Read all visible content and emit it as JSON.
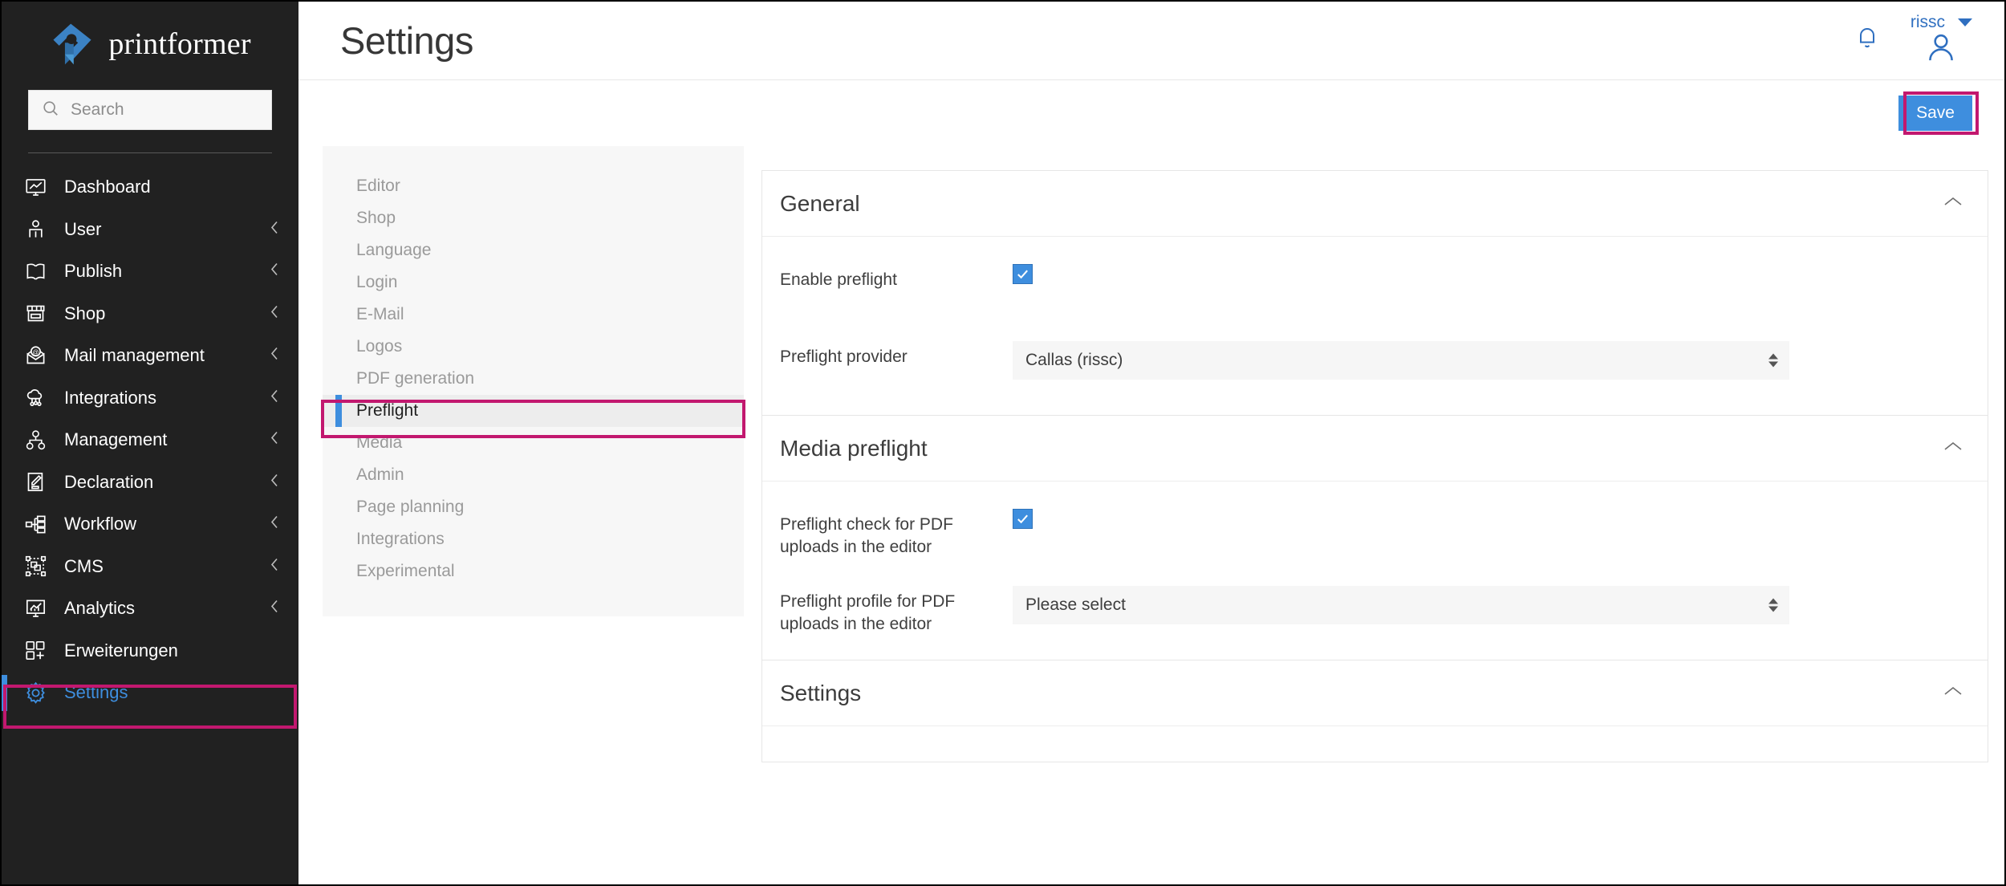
{
  "brand": {
    "name": "printformer"
  },
  "search": {
    "placeholder": "Search",
    "value": ""
  },
  "sidebar": {
    "items": [
      {
        "label": "Dashboard",
        "icon": "monitor-chart-icon",
        "has_chevron": false,
        "active": false
      },
      {
        "label": "User",
        "icon": "user-icon",
        "has_chevron": true,
        "active": false
      },
      {
        "label": "Publish",
        "icon": "book-open-icon",
        "has_chevron": true,
        "active": false
      },
      {
        "label": "Shop",
        "icon": "storefront-icon",
        "has_chevron": true,
        "active": false
      },
      {
        "label": "Mail management",
        "icon": "mail-at-icon",
        "has_chevron": true,
        "active": false
      },
      {
        "label": "Integrations",
        "icon": "cloud-nodes-icon",
        "has_chevron": true,
        "active": false
      },
      {
        "label": "Management",
        "icon": "org-chart-people-icon",
        "has_chevron": true,
        "active": false
      },
      {
        "label": "Declaration",
        "icon": "document-pencil-icon",
        "has_chevron": true,
        "active": false
      },
      {
        "label": "Workflow",
        "icon": "workflow-nodes-icon",
        "has_chevron": true,
        "active": false
      },
      {
        "label": "CMS",
        "icon": "layers-select-icon",
        "has_chevron": true,
        "active": false
      },
      {
        "label": "Analytics",
        "icon": "monitor-analytics-icon",
        "has_chevron": true,
        "active": false
      },
      {
        "label": "Erweiterungen",
        "icon": "extensions-plus-icon",
        "has_chevron": false,
        "active": false
      },
      {
        "label": "Settings",
        "icon": "gear-icon",
        "has_chevron": false,
        "active": true
      }
    ]
  },
  "header": {
    "title": "Settings",
    "user_name": "rissc",
    "bell_icon": "bell-icon",
    "avatar_icon": "user-avatar-icon",
    "caret_icon": "chevron-down-icon"
  },
  "toolbar": {
    "save_label": "Save"
  },
  "subnav": {
    "items": [
      {
        "label": "Editor",
        "active": false
      },
      {
        "label": "Shop",
        "active": false
      },
      {
        "label": "Language",
        "active": false
      },
      {
        "label": "Login",
        "active": false
      },
      {
        "label": "E-Mail",
        "active": false
      },
      {
        "label": "Logos",
        "active": false
      },
      {
        "label": "PDF generation",
        "active": false
      },
      {
        "label": "Preflight",
        "active": true
      },
      {
        "label": "Media",
        "active": false
      },
      {
        "label": "Admin",
        "active": false
      },
      {
        "label": "Page planning",
        "active": false
      },
      {
        "label": "Integrations",
        "active": false
      },
      {
        "label": "Experimental",
        "active": false
      }
    ]
  },
  "panels": {
    "general": {
      "title": "General",
      "collapse_icon": "chevron-up-icon",
      "enable_preflight": {
        "label": "Enable preflight",
        "checked": true
      },
      "provider": {
        "label": "Preflight provider",
        "value": "Callas (rissc)"
      }
    },
    "media_preflight": {
      "title": "Media preflight",
      "collapse_icon": "chevron-up-icon",
      "check_uploads": {
        "label": "Preflight check for PDF uploads in the editor",
        "checked": true
      },
      "profile": {
        "label": "Preflight profile for PDF uploads in the editor",
        "value": "Please select"
      }
    },
    "settings": {
      "title": "Settings",
      "collapse_icon": "chevron-up-icon"
    }
  },
  "colors": {
    "accent_blue": "#3e8ede",
    "highlight_pink": "#c2186f",
    "sidebar_bg": "#212121",
    "subnav_bg": "#f7f7f7"
  }
}
